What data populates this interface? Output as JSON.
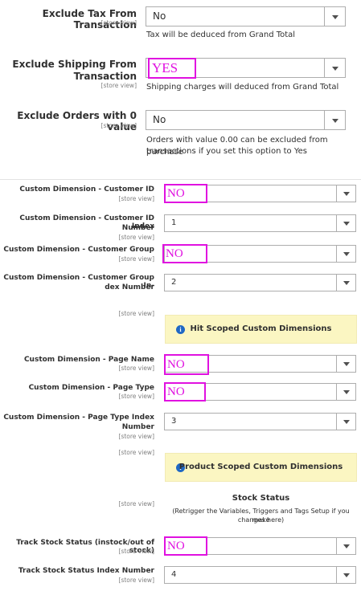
{
  "top_section": {
    "exclude_tax": {
      "label": "Exclude Tax From Transaction",
      "scope": "[store view]",
      "value": "No",
      "note": "Tax will be deduced from Grand Total"
    },
    "exclude_shipping": {
      "label_line1": "Exclude Shipping From",
      "label_line2": "Transaction",
      "scope": "[store view]",
      "value": "YES",
      "note": "Shipping charges will deduced from Grand Total"
    },
    "exclude_zero": {
      "label": "Exclude Orders with 0 value",
      "scope": "[store view]",
      "value": "No",
      "note_line1": "Orders with value 0.00 can be excluded from purchase",
      "note_line2": "transactions if you set this option to Yes"
    }
  },
  "dimensions": {
    "customer_id": {
      "label": "Custom Dimension - Customer ID",
      "scope": "[store view]",
      "value": "NO"
    },
    "customer_id_index": {
      "label_line1": "Custom Dimension - Customer ID Index",
      "label_line2": "Number",
      "scope": "[store view]",
      "value": "1"
    },
    "customer_group": {
      "label": "Custom Dimension - Customer Group",
      "scope": "[store view]",
      "value": "NO"
    },
    "customer_group_index": {
      "label_line1": "Custom Dimension - Customer Group In-",
      "label_line2": "dex Number",
      "scope": "[store view]",
      "value": "2"
    },
    "hit_scope": {
      "scope": "[store view]",
      "title": "Hit Scoped Custom Dimensions"
    },
    "page_name": {
      "label": "Custom Dimension - Page Name",
      "scope": "[store view]",
      "value": "NO"
    },
    "page_type": {
      "label": "Custom Dimension - Page Type",
      "scope": "[store view]",
      "value": "NO"
    },
    "page_type_index": {
      "label_line1": "Custom Dimension - Page Type Index",
      "label_line2": "Number",
      "scope": "[store view]",
      "value": "3"
    },
    "product_scope": {
      "scope": "[store view]",
      "title": "Product Scoped Custom Dimensions"
    }
  },
  "stock": {
    "scope": "[store view]",
    "title": "Stock Status",
    "sub_line1": "(Retrigger the Variables, Triggers and Tags Setup if you make",
    "sub_line2": "changes here)",
    "track": {
      "label": "Track Stock Status (instock/out of stock)",
      "scope": "[store view]",
      "value": "NO"
    },
    "track_index": {
      "label": "Track Stock Status Index Number",
      "scope": "[store view]",
      "value": "4"
    }
  },
  "icons": {
    "info": "info-icon",
    "dropdown": "chevron-down-icon"
  },
  "colors": {
    "highlight": "#e011e0",
    "banner": "#fbf6c2",
    "info": "#1f68c4"
  }
}
